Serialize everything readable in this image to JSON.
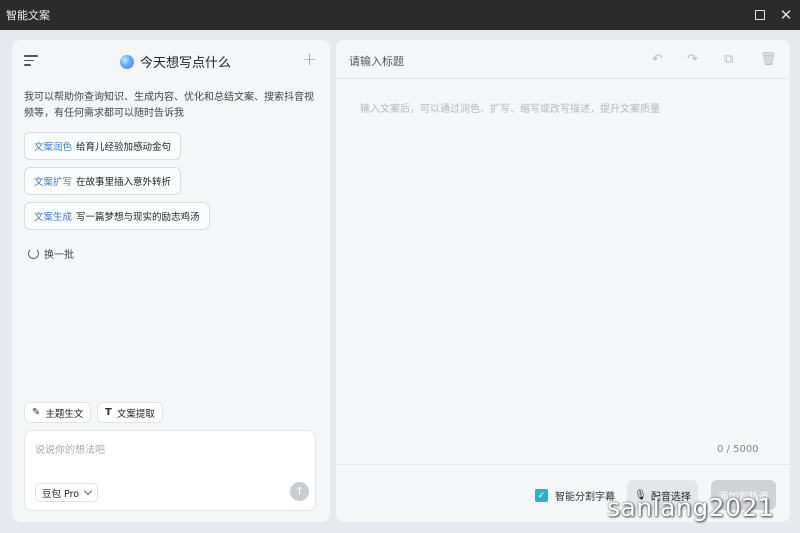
{
  "window": {
    "title": "智能文案"
  },
  "left": {
    "header_title": "今天想写点什么",
    "intro": "我可以帮助你查询知识、生成内容、优化和总结文案、搜索抖音视频等，有任何需求都可以随时告诉我",
    "suggestions": [
      {
        "tag": "文案润色",
        "text": "给育儿经验加感动金句"
      },
      {
        "tag": "文案扩写",
        "text": "在故事里插入意外转折"
      },
      {
        "tag": "文案生成",
        "text": "写一篇梦想与现实的励志鸡汤"
      }
    ],
    "refresh_label": "换一批",
    "tools": [
      {
        "label": "主题生文",
        "icon": "pen-sparkle-icon"
      },
      {
        "label": "文案提取",
        "icon": "text-t-icon"
      }
    ],
    "chat_placeholder": "说说你的想法吧",
    "model": "豆包 Pro"
  },
  "right": {
    "title_placeholder": "请输入标题",
    "body_placeholder": "输入文案后，可以通过润色、扩写、缩写或改写描述，提升文案质量",
    "counter": "0 / 5000",
    "subtitle_label": "智能分割字幕",
    "subtitle_checked": true,
    "voice_button": "配音选择",
    "add_button": "添加到轨道"
  },
  "watermark": "sanlang2021",
  "colors": {
    "accent": "#2bb3c7",
    "tag_blue": "#3a7bd5",
    "titlebar": "#2b2b2b"
  }
}
